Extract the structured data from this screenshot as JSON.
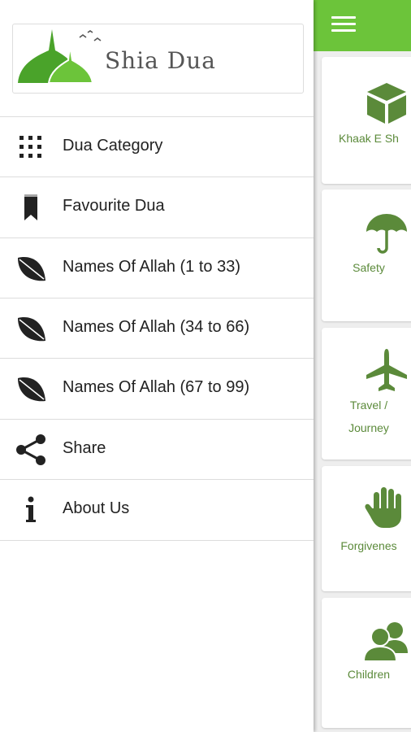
{
  "app": {
    "title": "Shia Dua",
    "accent": "#6cc43a",
    "card_text_color": "#5b8a3a"
  },
  "drawer": {
    "logo_text": "Shia Dua",
    "items": [
      {
        "label": "Dua Category",
        "icon": "grid-icon"
      },
      {
        "label": "Favourite Dua",
        "icon": "bookmark-icon"
      },
      {
        "label": "Names Of Allah (1 to 33)",
        "icon": "leaf-icon"
      },
      {
        "label": "Names Of Allah (34 to 66)",
        "icon": "leaf-icon"
      },
      {
        "label": "Names Of Allah (67 to 99)",
        "icon": "leaf-icon"
      },
      {
        "label": "Share",
        "icon": "share-icon"
      },
      {
        "label": "About Us",
        "icon": "info-icon"
      }
    ]
  },
  "main": {
    "categories": [
      {
        "lines": [
          "Khaak E Sh"
        ],
        "icon": "box-icon"
      },
      {
        "lines": [
          "Safety"
        ],
        "icon": "umbrella-icon"
      },
      {
        "lines": [
          "Travel /",
          "Journey"
        ],
        "icon": "airplane-icon"
      },
      {
        "lines": [
          "Forgivenes"
        ],
        "icon": "hand-icon"
      },
      {
        "lines": [
          "Children"
        ],
        "icon": "people-icon"
      }
    ]
  }
}
